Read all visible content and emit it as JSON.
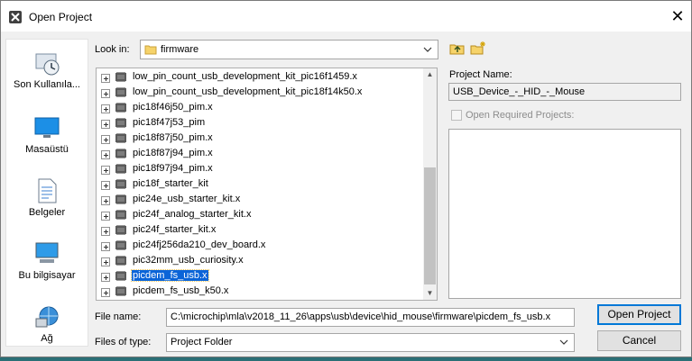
{
  "window": {
    "title": "Open Project",
    "close_glyph": "✕"
  },
  "places": [
    {
      "label": "Son Kullanıla...",
      "icon": "recent-places-icon"
    },
    {
      "label": "Masaüstü",
      "icon": "desktop-icon"
    },
    {
      "label": "Belgeler",
      "icon": "documents-icon"
    },
    {
      "label": "Bu bilgisayar",
      "icon": "computer-icon"
    },
    {
      "label": "Ağ",
      "icon": "network-icon"
    }
  ],
  "look_in": {
    "label": "Look in:",
    "value": "firmware"
  },
  "tree_items": [
    {
      "label": "low_pin_count_usb_development_kit_pic16f1459.x"
    },
    {
      "label": "low_pin_count_usb_development_kit_pic18f14k50.x"
    },
    {
      "label": "pic18f46j50_pim.x"
    },
    {
      "label": "pic18f47j53_pim"
    },
    {
      "label": "pic18f87j50_pim.x"
    },
    {
      "label": "pic18f87j94_pim.x"
    },
    {
      "label": "pic18f97j94_pim.x"
    },
    {
      "label": "pic18f_starter_kit"
    },
    {
      "label": "pic24e_usb_starter_kit.x"
    },
    {
      "label": "pic24f_analog_starter_kit.x"
    },
    {
      "label": "pic24f_starter_kit.x"
    },
    {
      "label": "pic24fj256da210_dev_board.x"
    },
    {
      "label": "pic32mm_usb_curiosity.x"
    },
    {
      "label": "picdem_fs_usb.x",
      "selected": true
    },
    {
      "label": "picdem_fs_usb_k50.x"
    }
  ],
  "project_name": {
    "label": "Project Name:",
    "value": "USB_Device_-_HID_-_Mouse"
  },
  "open_required": {
    "label": "Open Required Projects:",
    "checked": false
  },
  "file_name": {
    "label": "File name:",
    "value": "C:\\microchip\\mla\\v2018_11_26\\apps\\usb\\device\\hid_mouse\\firmware\\picdem_fs_usb.x"
  },
  "files_of_type": {
    "label": "Files of type:",
    "value": "Project Folder"
  },
  "buttons": {
    "open": "Open Project",
    "cancel": "Cancel"
  },
  "colors": {
    "selection": "#0a64d8",
    "default_button_border": "#0078d7"
  }
}
